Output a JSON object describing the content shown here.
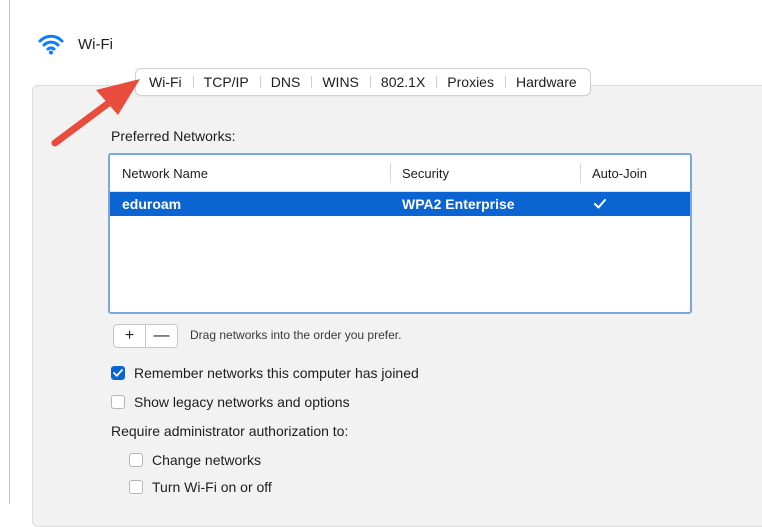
{
  "header": {
    "title": "Wi-Fi",
    "icon": "wifi-icon"
  },
  "tabs": [
    {
      "label": "Wi-Fi",
      "active": true
    },
    {
      "label": "TCP/IP",
      "active": false
    },
    {
      "label": "DNS",
      "active": false
    },
    {
      "label": "WINS",
      "active": false
    },
    {
      "label": "802.1X",
      "active": false
    },
    {
      "label": "Proxies",
      "active": false
    },
    {
      "label": "Hardware",
      "active": false
    }
  ],
  "preferred_networks": {
    "label": "Preferred Networks:",
    "columns": [
      "Network Name",
      "Security",
      "Auto-Join"
    ],
    "rows": [
      {
        "name": "eduroam",
        "security": "WPA2 Enterprise",
        "auto_join": true,
        "selected": true
      }
    ]
  },
  "buttons": {
    "add": "+",
    "remove": "—"
  },
  "drag_hint": "Drag networks into the order you prefer.",
  "options": {
    "remember": {
      "label": "Remember networks this computer has joined",
      "checked": true
    },
    "legacy": {
      "label": "Show legacy networks and options",
      "checked": false
    }
  },
  "require_label": "Require administrator authorization to:",
  "admin_options": {
    "change_networks": {
      "label": "Change networks",
      "checked": false
    },
    "turn_wifi": {
      "label": "Turn Wi-Fi on or off",
      "checked": false
    }
  },
  "colors": {
    "accent": "#0a64d2",
    "arrow": "#e84c3d"
  }
}
